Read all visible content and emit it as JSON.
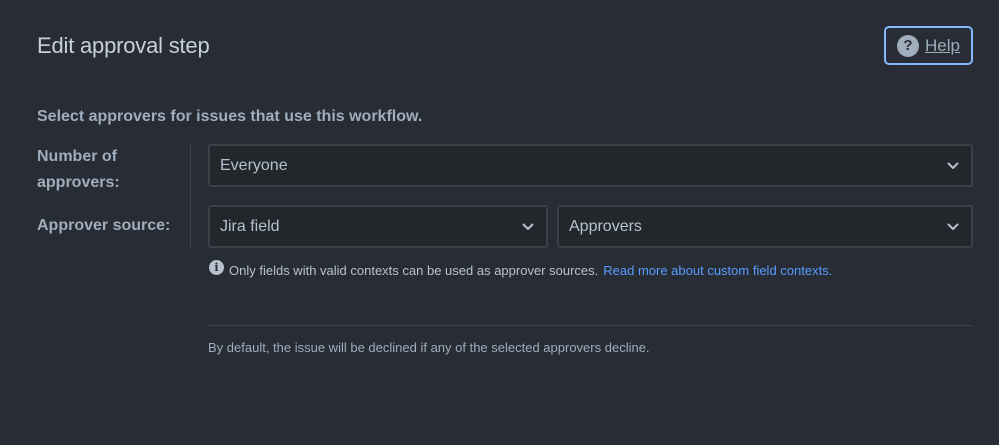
{
  "header": {
    "title": "Edit approval step",
    "help_label": "Help"
  },
  "intro": "Select approvers for issues that use this workflow.",
  "fields": {
    "number_of_approvers": {
      "label_line1": "Number of",
      "label_line2": "approvers:",
      "value": "Everyone"
    },
    "approver_source": {
      "label": "Approver source:",
      "source_type": "Jira field",
      "field": "Approvers"
    }
  },
  "info": {
    "text": "Only fields with valid contexts can be used as approver sources.",
    "link": "Read more about custom field contexts."
  },
  "footer_note": "By default, the issue will be declined if any of the selected approvers decline.",
  "colors": {
    "background": "#282c35",
    "accent_link": "#579dff",
    "help_border": "#85b8ff"
  }
}
